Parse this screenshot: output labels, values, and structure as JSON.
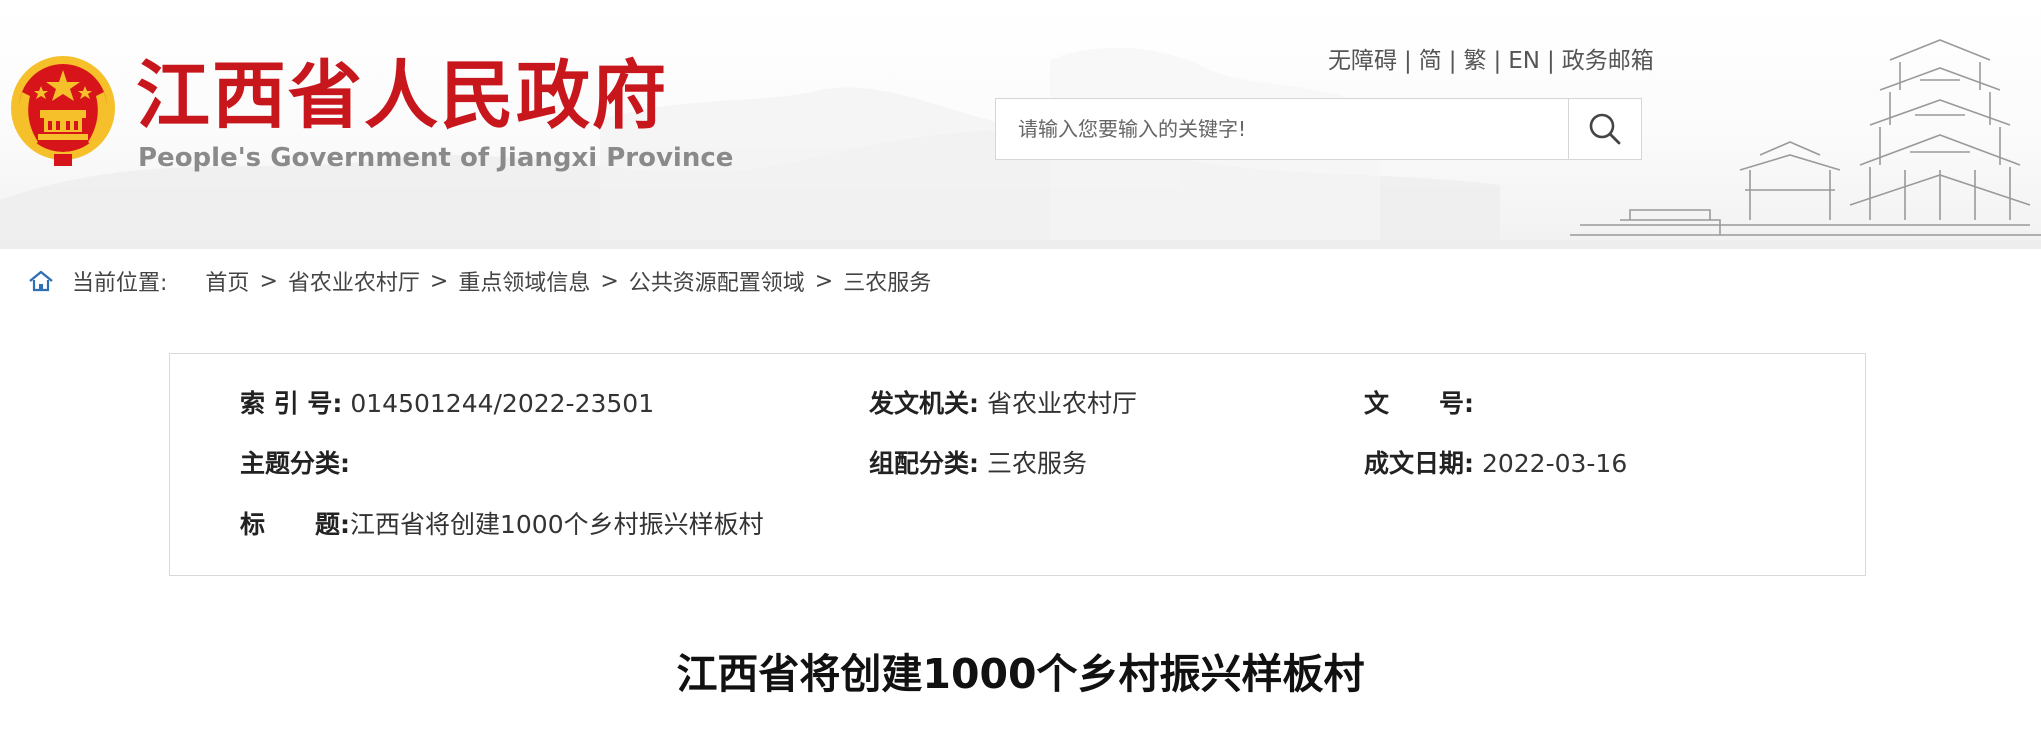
{
  "header": {
    "site_title": "江西省人民政府",
    "site_subtitle": "People's Government of Jiangxi Province",
    "top_links": [
      "无障碍",
      "简",
      "繁",
      "EN",
      "政务邮箱"
    ],
    "top_link_separator": "|",
    "search": {
      "placeholder": "请输入您要输入的关键字!",
      "value": ""
    }
  },
  "breadcrumb": {
    "label": "当前位置:",
    "items": [
      "首页",
      "省农业农村厅",
      "重点领域信息",
      "公共资源配置领域",
      "三农服务"
    ],
    "separator": ">"
  },
  "info": {
    "index_label": "索 引 号:",
    "index_value": "014501244/2022-23501",
    "issuer_label": "发文机关:",
    "issuer_value": "省农业农村厅",
    "docno_label": "文　　号:",
    "docno_value": "",
    "topic_label": "主题分类:",
    "topic_value": "",
    "group_label": "组配分类:",
    "group_value": "三农服务",
    "date_label": "成文日期:",
    "date_value": "2022-03-16",
    "title_label": "标　　题:",
    "title_value": "江西省将创建1000个乡村振兴样板村"
  },
  "article": {
    "title": "江西省将创建1000个乡村振兴样板村"
  },
  "icons": {
    "emblem": "national-emblem-icon",
    "search": "search-icon",
    "home": "home-icon"
  },
  "colors": {
    "brand_red": "#c8161d",
    "emblem_gold": "#f5c02a",
    "text_dark": "#222222",
    "border": "#d9d9d9"
  }
}
